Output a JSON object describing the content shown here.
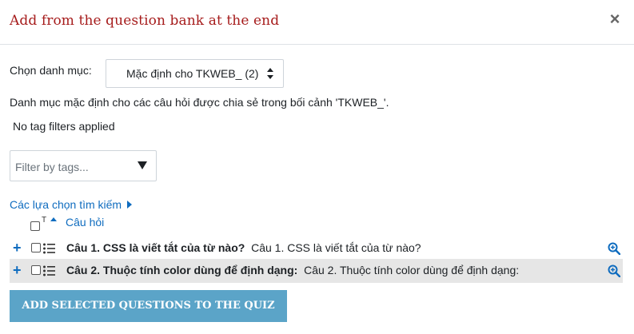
{
  "modal": {
    "title": "Add from the question bank at the end",
    "close_label": "×"
  },
  "category": {
    "label": "Chọn danh mục:",
    "selected": "Mặc định cho TKWEB_ (2)",
    "description": "Danh mục mặc định cho các câu hỏi được chia sẻ trong bối cảnh 'TKWEB_'."
  },
  "tags": {
    "no_filter_text": "No tag filters applied",
    "placeholder": "Filter by tags..."
  },
  "search_options": {
    "label": "Các lựa chọn tìm kiếm"
  },
  "table": {
    "type_col": "T",
    "question_col": "Câu hỏi",
    "rows": [
      {
        "name": "Câu 1. CSS là viết tắt của từ nào?",
        "text": "Câu 1. CSS là viết tắt của từ nào?"
      },
      {
        "name": "Câu 2. Thuộc tính color dùng để định dạng:",
        "text": "Câu 2. Thuộc tính color dùng để định dạng:"
      }
    ]
  },
  "actions": {
    "add_selected": "ADD SELECTED QUESTIONS TO THE QUIZ"
  },
  "colors": {
    "title": "#a61c1c",
    "link": "#0f6cbf",
    "button": "#5ba4c8",
    "row_alt": "#e6e6e6"
  },
  "icons": {
    "close": "close-icon",
    "select_arrows": "select-arrows-icon",
    "dropdown": "caret-down-icon",
    "expand": "caret-right-icon",
    "sort": "sort-asc-icon",
    "add": "plus-icon",
    "question_type": "multichoice-icon",
    "preview": "zoom-icon"
  }
}
